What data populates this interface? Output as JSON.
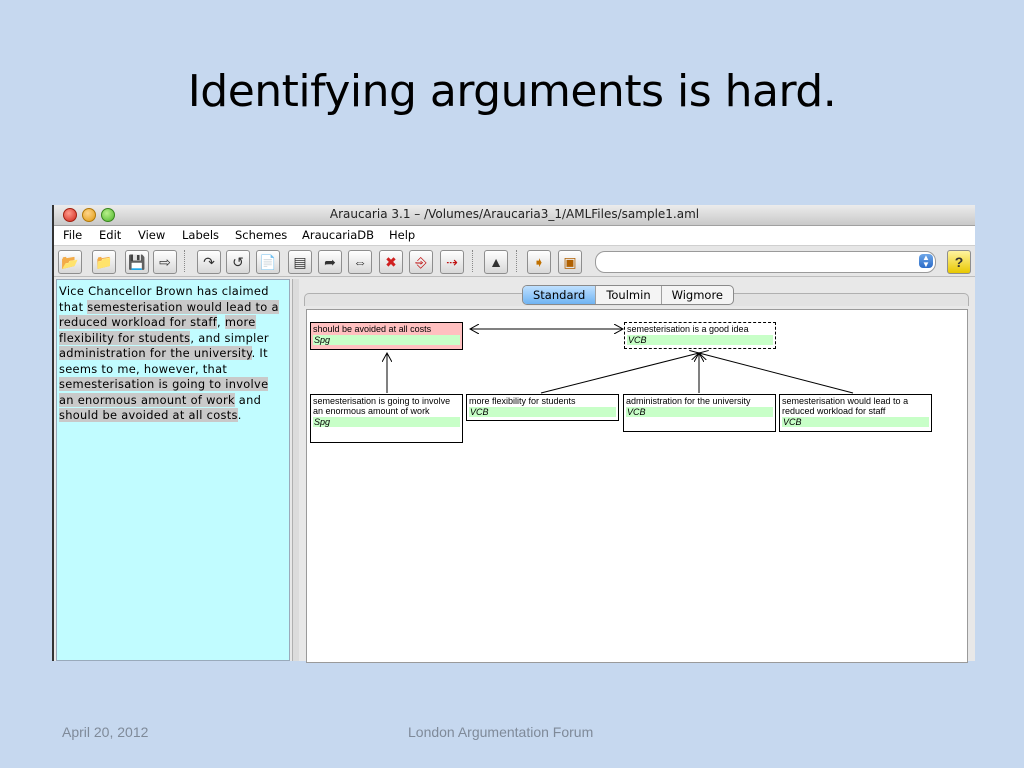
{
  "slide": {
    "title": "Identifying arguments is hard.",
    "footer_date": "April 20, 2012",
    "footer_center": "London Argumentation Forum"
  },
  "window": {
    "title": "Araucaria 3.1  – /Volumes/Araucaria3_1/AMLFiles/sample1.aml",
    "menu": [
      "File",
      "Edit",
      "View",
      "Labels",
      "Schemes",
      "AraucariaDB",
      "Help"
    ],
    "toolbar_icons": [
      "open-folder-icon",
      "open-folder-icon",
      "save-icon",
      "export-icon",
      "undo-icon",
      "redo-icon",
      "new-document-icon",
      "document-icon",
      "back-icon",
      "swap-icon",
      "delete-icon",
      "pin-icon",
      "unpin-icon",
      "tree-icon",
      "import-icon",
      "database-icon",
      "help-icon"
    ],
    "help_label": "?",
    "scheme_select_value": ""
  },
  "text_pane": {
    "segments": [
      {
        "text": "Vice Chancellor Brown has claimed that ",
        "hl": false
      },
      {
        "text": "semesterisation would lead to a reduced workload for staff",
        "hl": true
      },
      {
        "text": ", ",
        "hl": false
      },
      {
        "text": "more flexibility for students",
        "hl": true
      },
      {
        "text": ", and simpler ",
        "hl": false
      },
      {
        "text": "administration for the university",
        "hl": true
      },
      {
        "text": ". It seems to me, however, that ",
        "hl": false
      },
      {
        "text": "semesterisation is going to involve an enormous amount of work",
        "hl": true
      },
      {
        "text": " and ",
        "hl": false
      },
      {
        "text": "should be avoided at all costs",
        "hl": true
      },
      {
        "text": ".",
        "hl": false
      }
    ]
  },
  "diagram": {
    "tabs": [
      "Standard",
      "Toulmin",
      "Wigmore"
    ],
    "active_tab": "Standard",
    "nodes": {
      "avoided": {
        "text": "should be avoided at all costs",
        "owner": "Spg"
      },
      "good_idea": {
        "text": "semesterisation is a good idea",
        "owner": "VCB"
      },
      "enormous": {
        "text": "semesterisation is going to involve an enormous amount of work",
        "owner": "Spg"
      },
      "flexibility": {
        "text": "more flexibility for students",
        "owner": "VCB"
      },
      "administration": {
        "text": "administration for the university",
        "owner": "VCB"
      },
      "workload": {
        "text": "semesterisation would lead to a reduced workload for staff",
        "owner": "VCB"
      }
    }
  }
}
